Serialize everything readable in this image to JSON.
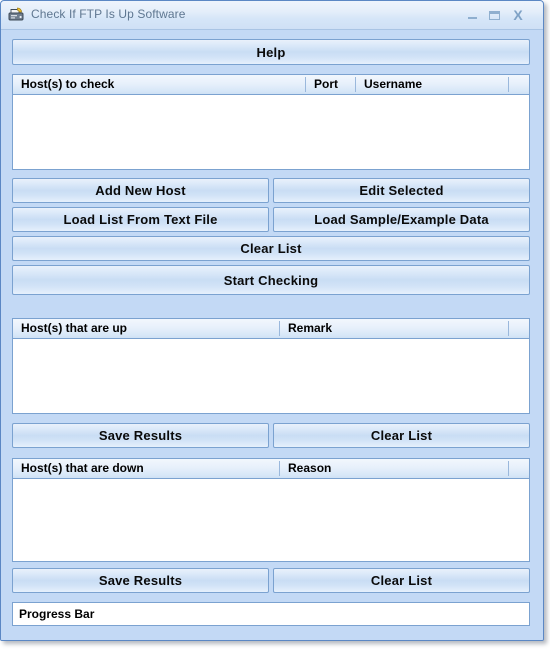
{
  "window": {
    "title": "Check If FTP Is Up Software",
    "icon": "ftp-app-icon",
    "controls": {
      "minimize": "–",
      "maximize": "□",
      "close": "X"
    }
  },
  "toolbar": {
    "help_label": "Help"
  },
  "lists": {
    "to_check": {
      "columns": [
        "Host(s) to check",
        "Port",
        "Username",
        ""
      ],
      "rows": []
    },
    "up": {
      "columns": [
        "Host(s) that are up",
        "Remark",
        ""
      ],
      "rows": []
    },
    "down": {
      "columns": [
        "Host(s) that are down",
        "Reason",
        ""
      ],
      "rows": []
    }
  },
  "buttons": {
    "add_new_host": "Add New Host",
    "edit_selected": "Edit Selected",
    "load_list_from_text_file": "Load List From Text File",
    "load_sample_example_data": "Load Sample/Example Data",
    "clear_list_main": "Clear List",
    "start_checking": "Start Checking",
    "save_results_up": "Save Results",
    "clear_list_up": "Clear List",
    "save_results_down": "Save Results",
    "clear_list_down": "Clear List"
  },
  "progress": {
    "label": "Progress Bar",
    "value": 0
  },
  "colors": {
    "window_background": "#c3d9f5",
    "window_border": "#5b87c4",
    "button_border": "#7ba2d0",
    "list_background": "#ffffff",
    "title_text": "#5f7791"
  }
}
